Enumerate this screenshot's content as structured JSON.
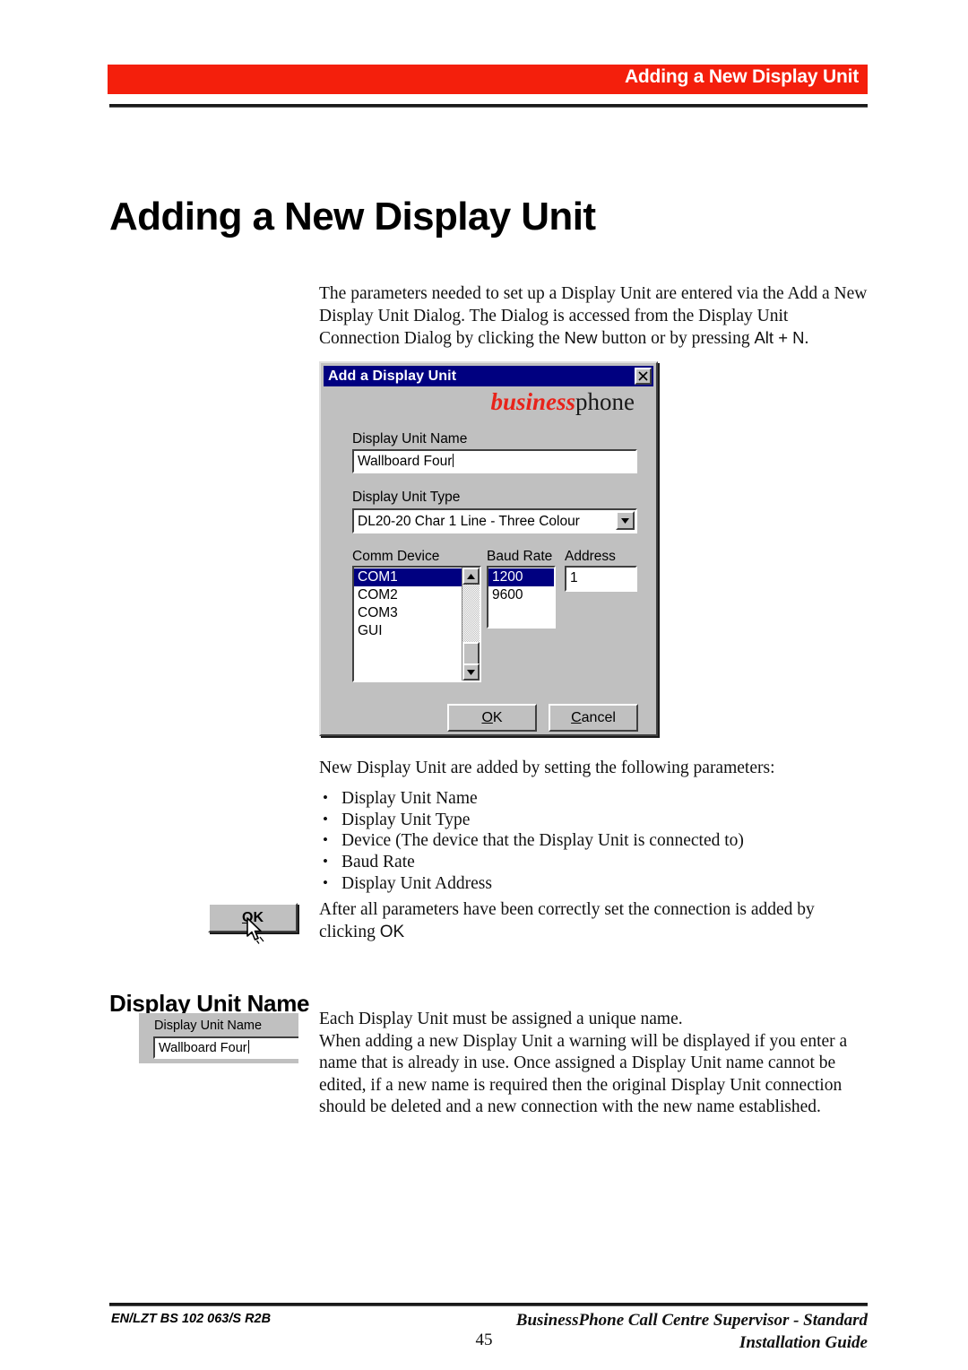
{
  "header": {
    "running_title": "Adding a New Display Unit",
    "banner_color": "#f41f0c"
  },
  "page_title": "Adding a New Display Unit",
  "intro": {
    "part1": "The parameters needed to set up a Display Unit are entered via the Add a New Display Unit Dialog. The Dialog is accessed from the Display Unit Connection Dialog by clicking the ",
    "new_button": "New",
    "part2": " button or by pressing ",
    "shortcut": "Alt + N",
    "part3": "."
  },
  "dialog": {
    "title": "Add a Display Unit",
    "close_icon": "close-x-icon",
    "brand": {
      "business": "business",
      "phone": "phone",
      "business_color": "#e8231a"
    },
    "name_label": "Display Unit Name",
    "name_value": "Wallboard Four",
    "type_label": "Display Unit Type",
    "type_value": "DL20-20 Char 1 Line - Three Colour",
    "type_dropdown_icon": "chevron-down-icon",
    "comm_label": "Comm Device",
    "comm_items": [
      "COM1",
      "COM2",
      "COM3",
      "GUI"
    ],
    "comm_selected": "COM1",
    "baud_label": "Baud Rate",
    "baud_items": [
      "1200",
      "9600"
    ],
    "baud_selected": "1200",
    "address_label": "Address",
    "address_value": "1",
    "scrollbar_up_icon": "arrow-up-icon",
    "scrollbar_down_icon": "arrow-down-icon",
    "ok_label_prefix": "O",
    "ok_label_rest": "K",
    "cancel_label_prefix": "C",
    "cancel_label_rest": "ancel"
  },
  "after_dialog_text": "New Display Unit are added by setting the following parameters:",
  "bullets": [
    "Display Unit Name",
    "Display Unit Type",
    "Device (The device that the Display Unit is connected to)",
    "Baud Rate",
    "Display Unit Address"
  ],
  "ok_paragraph": {
    "text": "After all parameters have been correctly set the connection is added by clicking ",
    "ok_word": "OK"
  },
  "margin_ok_graphic": {
    "button_label_prefix": "O",
    "button_label_rest": "K",
    "cursor_icon": "mouse-pointer-icon"
  },
  "section": {
    "heading": "Display Unit Name",
    "para1": "Each Display Unit must be assigned a unique name.",
    "para2": "When adding a new Display Unit a warning will be displayed if you enter a name that is already in use. Once assigned a Display Unit name cannot be edited, if a new name is required then the original Display Unit connection should be deleted and a new connection with the new name established."
  },
  "margin_name_graphic": {
    "label": "Display Unit Name",
    "value": "Wallboard Four"
  },
  "footer": {
    "left": "EN/LZT BS 102 063/S R2B",
    "page_number": "45",
    "right_line1": "BusinessPhone Call Centre Supervisor - Standard",
    "right_line2": "Installation Guide"
  }
}
